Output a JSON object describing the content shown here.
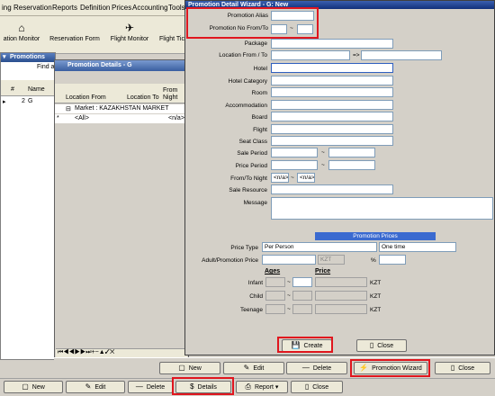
{
  "menubar": [
    "ing",
    "Reservation",
    "Reports",
    "Definition",
    "Prices",
    "Accounting",
    "Tools"
  ],
  "toolbar": [
    {
      "label": "ation Monitor",
      "icon": "home-icon"
    },
    {
      "label": "Reservation Form",
      "icon": "form-icon"
    },
    {
      "label": "Flight Monitor",
      "icon": "airplane-icon"
    },
    {
      "label": "Flight Tic",
      "icon": "ticket-icon"
    }
  ],
  "left_window": {
    "title": "Promotions",
    "find_label": "Find a",
    "columns": [
      "#",
      "Name"
    ],
    "rows": [
      {
        "num": "2",
        "name": "G"
      }
    ]
  },
  "mid_window": {
    "title": "Promotion Details - G",
    "columns": [
      "Location From",
      "Location To",
      "From Night"
    ],
    "group_row": "Market : KAZAKHSTAN MARKET",
    "row": {
      "from": "<All>",
      "to": "",
      "night": "<n/a>"
    }
  },
  "wizard": {
    "title": "Promotion Detail Wizard - G: New",
    "labels": {
      "alias": "Promotion Alias",
      "no_from_to": "Promotion No From/To",
      "package": "Package",
      "location": "Location From / To",
      "hotel": "Hotel",
      "hotel_category": "Hotel Category",
      "room": "Room",
      "accommodation": "Accommodation",
      "board": "Board",
      "flight": "Flight",
      "seat_class": "Seat Class",
      "sale_period": "Sale Period",
      "price_period": "Price Period",
      "from_to_night": "From/To Night",
      "sale_resource": "Sale Resource",
      "message": "Message"
    },
    "arrow": "=>",
    "dash": "~",
    "night_from": "<n/a>",
    "night_to": "<n/a>",
    "prices_header": "Promotion Prices",
    "price_type_label": "Price Type",
    "price_type_value": "Per Person",
    "price_type_value2": "One time",
    "adult_price_label": "Adult/Promotion Price",
    "currency": "KZT",
    "percent": "%",
    "ages_header": "Ages",
    "price_header": "Price",
    "age_rows": [
      "Infant",
      "Child",
      "Teenage"
    ],
    "create_label": "Create",
    "close_label": "Close"
  },
  "bottom_bar1": {
    "new": "New",
    "edit": "Edit",
    "delete": "Delete",
    "wizard": "Promotion Wizard",
    "close": "Close"
  },
  "bottom_bar2": {
    "new": "New",
    "edit": "Edit",
    "delete": "Delete",
    "details": "Details",
    "report": "Report",
    "close": "Close"
  }
}
